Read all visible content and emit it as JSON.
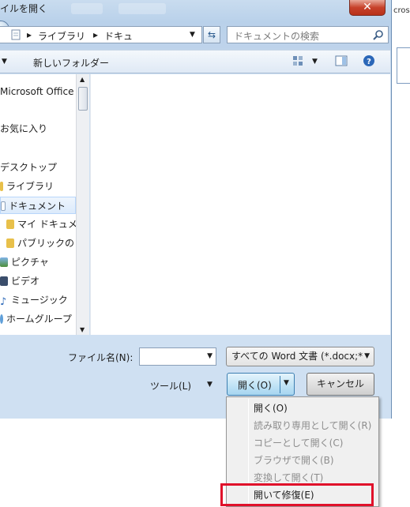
{
  "window": {
    "title": "イルを開く",
    "close_label": "✕"
  },
  "address": {
    "segments": [
      "ライブラリ",
      "ドキュ"
    ],
    "search_placeholder": "ドキュメントの検索"
  },
  "toolbar": {
    "new_folder_label": "新しいフォルダー"
  },
  "nav": {
    "items": [
      {
        "label": "Microsoft Office W",
        "icon": "office-icon",
        "selected": false
      },
      {
        "label": "お気に入り",
        "icon": "favorites-star-icon",
        "selected": false
      },
      {
        "label": "デスクトップ",
        "icon": "desktop-icon",
        "selected": false
      },
      {
        "label": "ライブラリ",
        "icon": "library-icon",
        "selected": false
      },
      {
        "label": "ドキュメント",
        "icon": "documents-icon",
        "selected": true
      },
      {
        "label": "マイ ドキュメ",
        "icon": "folder-icon",
        "selected": false
      },
      {
        "label": "パブリックの",
        "icon": "folder-icon",
        "selected": false
      },
      {
        "label": "ピクチャ",
        "icon": "pictures-icon",
        "selected": false
      },
      {
        "label": "ビデオ",
        "icon": "video-icon",
        "selected": false
      },
      {
        "label": "ミュージック",
        "icon": "music-icon",
        "selected": false
      },
      {
        "label": "ホームグループ",
        "icon": "homegroup-icon",
        "selected": false
      }
    ]
  },
  "bottom": {
    "filename_label": "ファイル名(N):",
    "filename_value": "",
    "filetype_value": "すべての Word 文書 (*.docx;*",
    "tools_label": "ツール(L)",
    "open_label": "開く(O)",
    "cancel_label": "キャンセル"
  },
  "background_window": {
    "fragment_text": "cros"
  },
  "open_menu": {
    "items": [
      {
        "label": "開く(O)",
        "enabled": true
      },
      {
        "label": "読み取り専用として開く(R)",
        "enabled": false
      },
      {
        "label": "コピーとして開く(C)",
        "enabled": false
      },
      {
        "label": "ブラウザで開く(B)",
        "enabled": false
      },
      {
        "label": "変換して開く(T)",
        "enabled": false
      },
      {
        "label": "開いて修復(E)",
        "enabled": true
      }
    ]
  },
  "colors": {
    "highlight_border": "#e0102a",
    "selected_nav": "#dbeafb"
  }
}
